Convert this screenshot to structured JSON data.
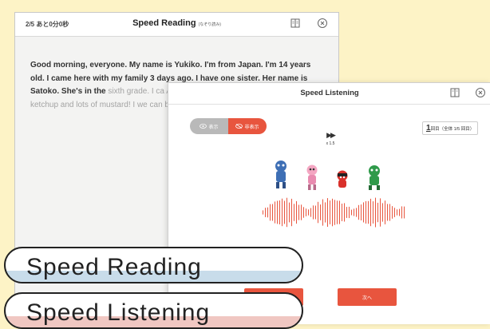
{
  "reading": {
    "progress": "2/5 あと0分0秒",
    "title": "Speed Reading",
    "title_ruby": "(なぞり読み)",
    "passage_read": "Good morning, everyone. My name is Yukiko. I'm from Japan. I'm 14 years old. I came here with my family 3 days ago. I have one sister. Her name is Satoko. She's in the",
    "passage_unread": " sixth grade. I ca America very much. I really like Am with ketchup and lots of mustard! I we can be friends. Thank you."
  },
  "listening": {
    "title": "Speed Listening",
    "toggle_show": "表示",
    "toggle_hide": "非表示",
    "speed_symbol": "▶▶",
    "speed_rate": "x 1.5",
    "round_num": "1",
    "round_text": "回目（全体 1/5 回目）",
    "back_label": "る",
    "next_label": "次へ"
  },
  "labels": {
    "reading": "Speed Reading",
    "listening": "Speed Listening"
  },
  "colors": {
    "background": "#fdf3c6",
    "accent": "#e8553e",
    "reading_band": "#c8dcea",
    "listening_band": "#f0c7c2"
  }
}
